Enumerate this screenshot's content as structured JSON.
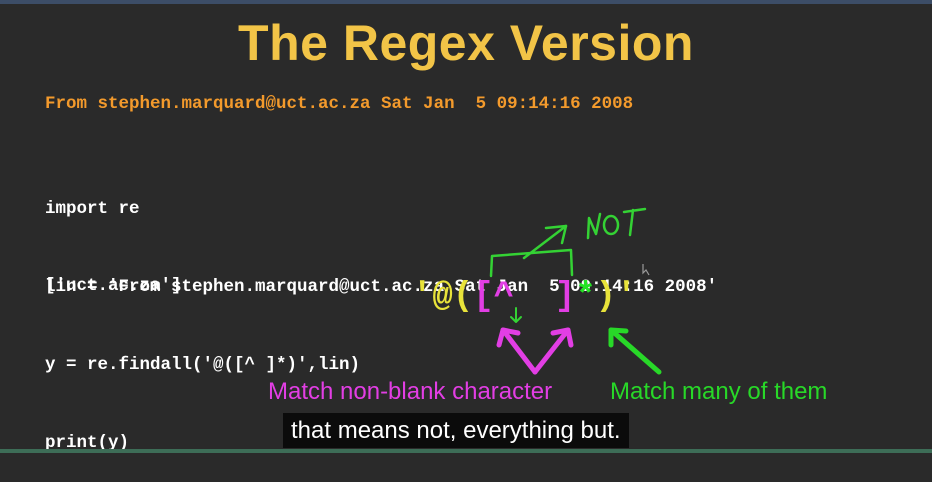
{
  "slide": {
    "title": "The Regex Version",
    "header_line": "From stephen.marquard@uct.ac.za Sat Jan  5 09:14:16 2008",
    "code_lines": [
      "import re",
      "lin = 'From stephen.marquard@uct.ac.za Sat Jan  5 09:14:16 2008'",
      "y = re.findall('@([^ ]*)',lin)",
      "print(y)"
    ],
    "output": "['uct.ac.za']",
    "regex_tokens": [
      "'",
      "@",
      "(",
      "[^  ]",
      "*",
      ")",
      "'"
    ],
    "annotation_magenta": "Match non-blank character",
    "annotation_green": "Match many of them",
    "handwritten_note": "not"
  },
  "captions": {
    "text": "that means not, everything but."
  },
  "colors": {
    "background": "#2a2a2a",
    "title": "#f2c447",
    "header": "#f39a2c",
    "code": "#ffffff",
    "regex_quote": "#e8e33a",
    "regex_bracket": "#e23ee4",
    "regex_star": "#24e324",
    "handwriting": "#34d234"
  }
}
